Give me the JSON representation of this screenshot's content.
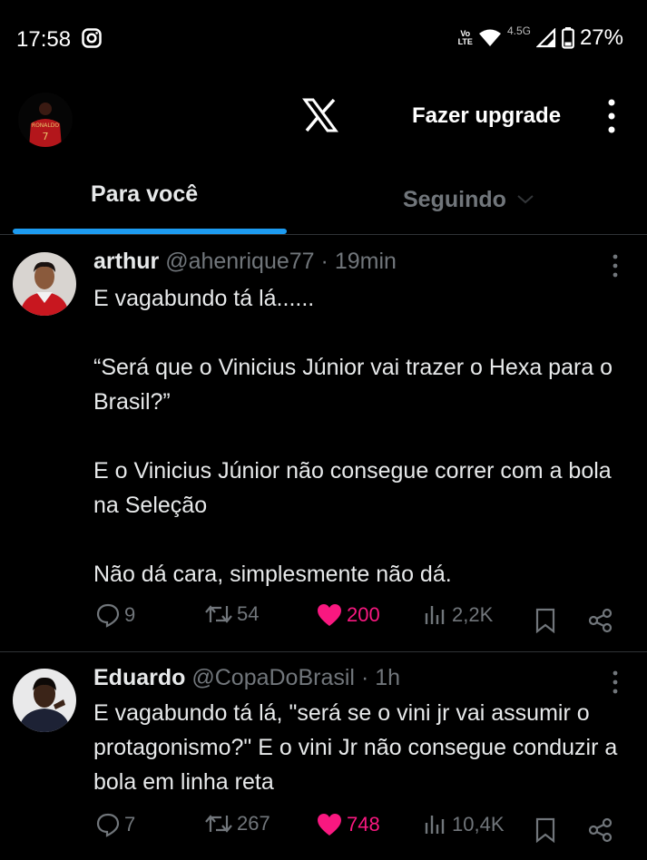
{
  "status_bar": {
    "time": "17:58",
    "volte": [
      "Vo",
      "LTE"
    ],
    "network": "4.5G",
    "battery": "27%"
  },
  "header": {
    "upgrade_label": "Fazer upgrade",
    "logo": "x-logo"
  },
  "tabs": {
    "for_you": "Para você",
    "following": "Seguindo"
  },
  "colors": {
    "accent": "#1d9bf0",
    "like": "#f91880",
    "muted": "#71767b"
  },
  "tweets": [
    {
      "name": "arthur",
      "handle": "@ahenrique77",
      "time": "· 19min",
      "paragraphs": [
        "E vagabundo tá lá......",
        "“Será que o Vinicius Júnior vai trazer o Hexa para o Brasil?”",
        "E o Vinicius Júnior não consegue correr com a bola na Seleção",
        "Não dá cara, simplesmente não dá."
      ],
      "replies": "9",
      "retweets": "54",
      "likes": "200",
      "views": "2,2K"
    },
    {
      "name": "Eduardo",
      "handle": "@CopaDoBrasil",
      "time": "· 1h",
      "paragraphs": [
        "E vagabundo tá lá, \"será se o vini jr vai assumir o protagonismo?\" E o vini Jr não consegue conduzir a bola em linha reta"
      ],
      "replies": "7",
      "retweets": "267",
      "likes": "748",
      "views": "10,4K"
    }
  ]
}
